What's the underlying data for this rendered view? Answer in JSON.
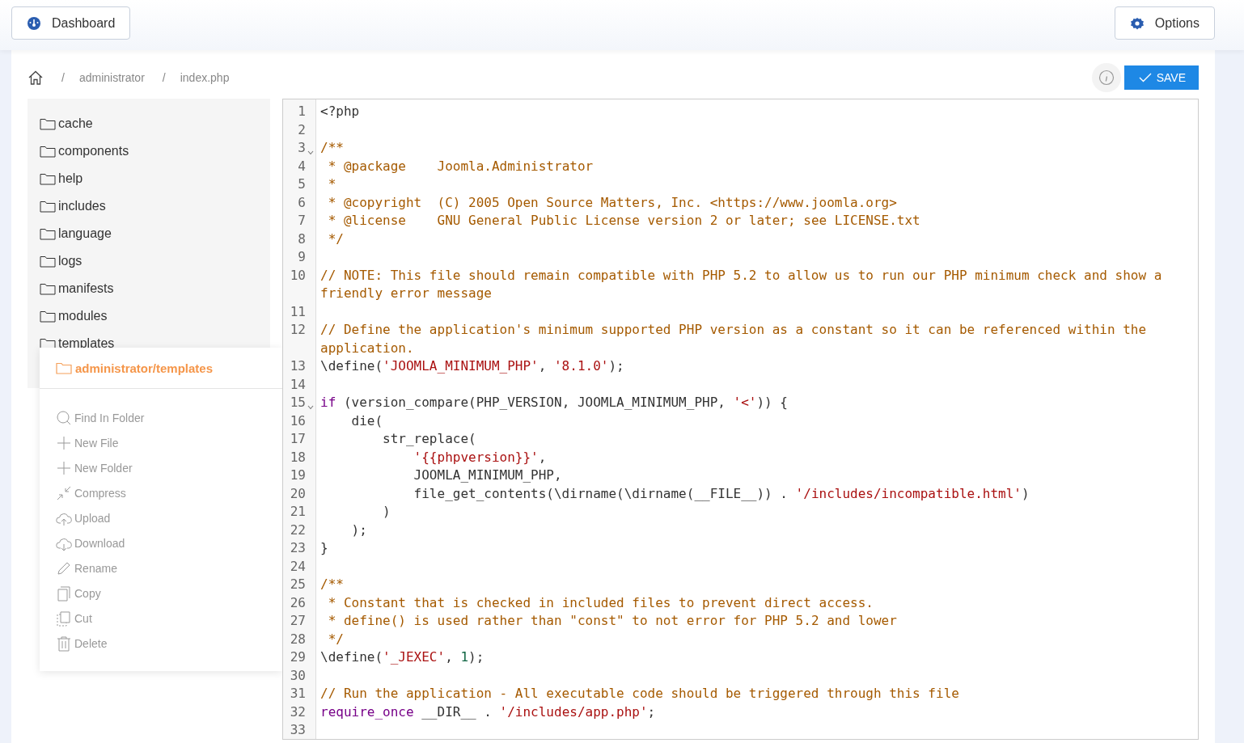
{
  "header": {
    "dashboard_button": "Dashboard",
    "options_button": "Options"
  },
  "breadcrumb": [
    {
      "separator": "/",
      "label": "administrator"
    },
    {
      "separator": "/",
      "label": "index.php"
    }
  ],
  "toolbar": {
    "save_button": "SAVE"
  },
  "folders": [
    "cache",
    "components",
    "help",
    "includes",
    "language",
    "logs",
    "manifests",
    "modules",
    "templates"
  ],
  "context_menu": {
    "title": "administrator/templates",
    "actions": [
      {
        "kind": "search",
        "label": "Find In Folder"
      },
      {
        "kind": "plus",
        "label": "New File"
      },
      {
        "kind": "plus",
        "label": "New Folder"
      },
      {
        "kind": "compress",
        "label": "Compress"
      },
      {
        "kind": "upload",
        "label": "Upload"
      },
      {
        "kind": "download",
        "label": "Download"
      },
      {
        "kind": "pencil",
        "label": "Rename"
      },
      {
        "kind": "copy",
        "label": "Copy"
      },
      {
        "kind": "cut",
        "label": "Cut"
      },
      {
        "kind": "trash",
        "label": "Delete"
      }
    ]
  },
  "editor": {
    "lines": [
      {
        "number": "1",
        "foldable": false,
        "tokens": [
          {
            "kind": "plain",
            "text": "<?php"
          }
        ]
      },
      {
        "number": "2",
        "foldable": false
      },
      {
        "number": "3",
        "foldable": true,
        "tokens": [
          {
            "kind": "comment",
            "text": "/**"
          }
        ]
      },
      {
        "number": "4",
        "foldable": false,
        "tokens": [
          {
            "kind": "comment",
            "text": " * @package    Joomla.Administrator"
          }
        ]
      },
      {
        "number": "5",
        "foldable": false,
        "tokens": [
          {
            "kind": "comment",
            "text": " *"
          }
        ]
      },
      {
        "number": "6",
        "foldable": false,
        "tokens": [
          {
            "kind": "comment",
            "text": " * @copyright  (C) 2005 Open Source Matters, Inc. <https://www.joomla.org>"
          }
        ]
      },
      {
        "number": "7",
        "foldable": false,
        "tokens": [
          {
            "kind": "comment",
            "text": " * @license    GNU General Public License version 2 or later; see LICENSE.txt"
          }
        ]
      },
      {
        "number": "8",
        "foldable": false,
        "tokens": [
          {
            "kind": "comment",
            "text": " */"
          }
        ]
      },
      {
        "number": "9",
        "foldable": false
      },
      {
        "number": "10",
        "foldable": false,
        "tokens": [
          {
            "kind": "comment",
            "text": "// NOTE: This file should remain compatible with PHP 5.2 to allow us to run our PHP minimum check and show a friendly error message"
          }
        ]
      },
      {
        "number": "11",
        "foldable": false
      },
      {
        "number": "12",
        "foldable": false,
        "tokens": [
          {
            "kind": "comment",
            "text": "// Define the application's minimum supported PHP version as a constant so it can be referenced within the application."
          }
        ]
      },
      {
        "number": "13",
        "foldable": false,
        "tokens": [
          {
            "kind": "plain",
            "text": "\\define("
          },
          {
            "kind": "string",
            "text": "'JOOMLA_MINIMUM_PHP'"
          },
          {
            "kind": "plain",
            "text": ", "
          },
          {
            "kind": "string",
            "text": "'8.1.0'"
          },
          {
            "kind": "plain",
            "text": ");"
          }
        ]
      },
      {
        "number": "14",
        "foldable": false
      },
      {
        "number": "15",
        "foldable": true,
        "tokens": [
          {
            "kind": "keyword",
            "text": "if"
          },
          {
            "kind": "plain",
            "text": " (version_compare(PHP_VERSION, JOOMLA_MINIMUM_PHP, "
          },
          {
            "kind": "string",
            "text": "'<'"
          },
          {
            "kind": "plain",
            "text": ")) {"
          }
        ]
      },
      {
        "number": "16",
        "foldable": false,
        "tokens": [
          {
            "kind": "plain",
            "text": "    die("
          }
        ]
      },
      {
        "number": "17",
        "foldable": false,
        "tokens": [
          {
            "kind": "plain",
            "text": "        str_replace("
          }
        ]
      },
      {
        "number": "18",
        "foldable": false,
        "tokens": [
          {
            "kind": "string",
            "text": "            '{{phpversion}}'"
          },
          {
            "kind": "plain",
            "text": ","
          }
        ]
      },
      {
        "number": "19",
        "foldable": false,
        "tokens": [
          {
            "kind": "plain",
            "text": "            JOOMLA_MINIMUM_PHP,"
          }
        ]
      },
      {
        "number": "20",
        "foldable": false,
        "tokens": [
          {
            "kind": "plain",
            "text": "            file_get_contents(\\dirname(\\dirname(__FILE__)) . "
          },
          {
            "kind": "string",
            "text": "'/includes/incompatible.html'"
          },
          {
            "kind": "plain",
            "text": ")"
          }
        ]
      },
      {
        "number": "21",
        "foldable": false,
        "tokens": [
          {
            "kind": "plain",
            "text": "        )"
          }
        ]
      },
      {
        "number": "22",
        "foldable": false,
        "tokens": [
          {
            "kind": "plain",
            "text": "    );"
          }
        ]
      },
      {
        "number": "23",
        "foldable": false,
        "tokens": [
          {
            "kind": "plain",
            "text": "}"
          }
        ]
      },
      {
        "number": "24",
        "foldable": false
      },
      {
        "number": "25",
        "foldable": false,
        "tokens": [
          {
            "kind": "comment",
            "text": "/**"
          }
        ]
      },
      {
        "number": "26",
        "foldable": false,
        "tokens": [
          {
            "kind": "comment",
            "text": " * Constant that is checked in included files to prevent direct access."
          }
        ]
      },
      {
        "number": "27",
        "foldable": false,
        "tokens": [
          {
            "kind": "comment",
            "text": " * define() is used rather than \"const\" to not error for PHP 5.2 and lower"
          }
        ]
      },
      {
        "number": "28",
        "foldable": false,
        "tokens": [
          {
            "kind": "comment",
            "text": " */"
          }
        ]
      },
      {
        "number": "29",
        "foldable": false,
        "tokens": [
          {
            "kind": "plain",
            "text": "\\define("
          },
          {
            "kind": "string",
            "text": "'_JEXEC'"
          },
          {
            "kind": "plain",
            "text": ", "
          },
          {
            "kind": "number",
            "text": "1"
          },
          {
            "kind": "plain",
            "text": ");"
          }
        ]
      },
      {
        "number": "30",
        "foldable": false
      },
      {
        "number": "31",
        "foldable": false,
        "tokens": [
          {
            "kind": "comment",
            "text": "// Run the application - All executable code should be triggered through this file"
          }
        ]
      },
      {
        "number": "32",
        "foldable": false,
        "tokens": [
          {
            "kind": "keyword",
            "text": "require_once"
          },
          {
            "kind": "plain",
            "text": " __DIR__ . "
          },
          {
            "kind": "string",
            "text": "'/includes/app.php'"
          },
          {
            "kind": "plain",
            "text": ";"
          }
        ]
      },
      {
        "number": "33",
        "foldable": false
      }
    ]
  }
}
